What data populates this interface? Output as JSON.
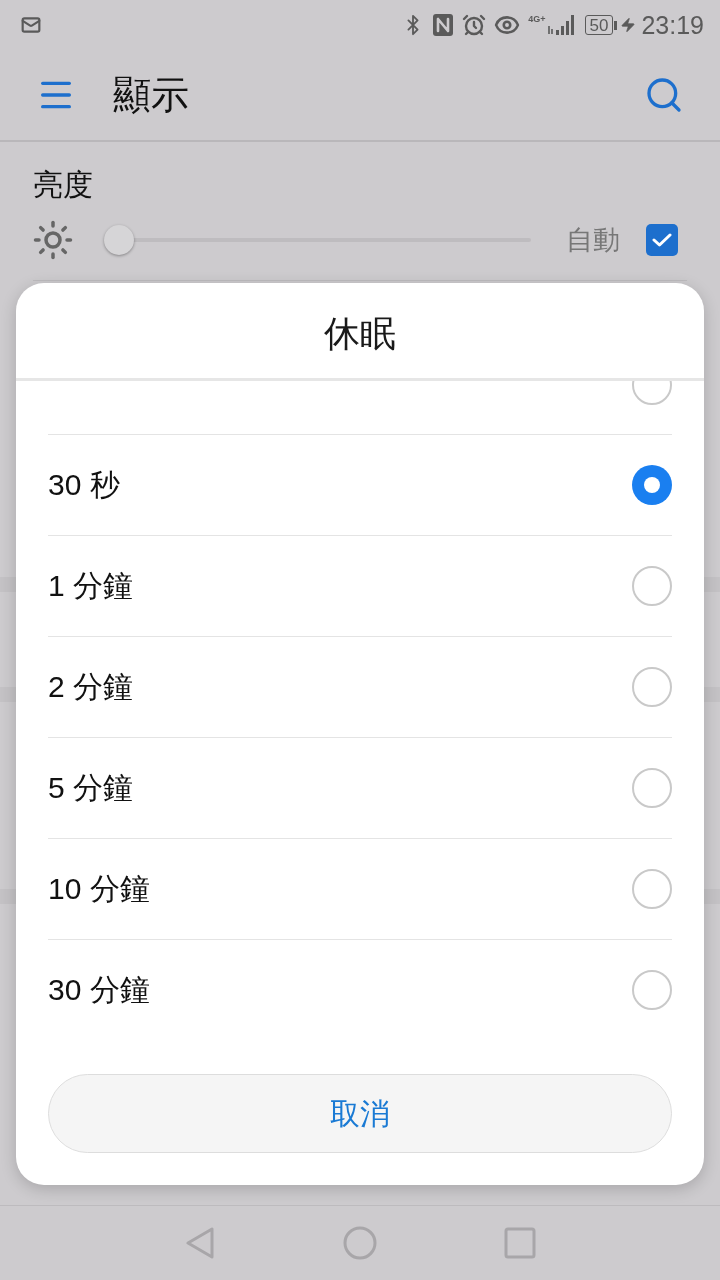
{
  "status_bar": {
    "network": "4G+",
    "battery": "50",
    "time": "23:19"
  },
  "app_bar": {
    "title": "顯示"
  },
  "brightness": {
    "label": "亮度",
    "level": 0,
    "auto_label": "自動",
    "auto_checked": true
  },
  "dialog": {
    "title": "休眠",
    "options": [
      {
        "selected": false
      },
      {
        "label": "30 秒",
        "selected": true
      },
      {
        "label": "1 分鐘",
        "selected": false
      },
      {
        "label": "2 分鐘",
        "selected": false
      },
      {
        "label": "5 分鐘",
        "selected": false
      },
      {
        "label": "10 分鐘",
        "selected": false
      },
      {
        "label": "30 分鐘",
        "selected": false
      }
    ],
    "cancel": "取消"
  }
}
